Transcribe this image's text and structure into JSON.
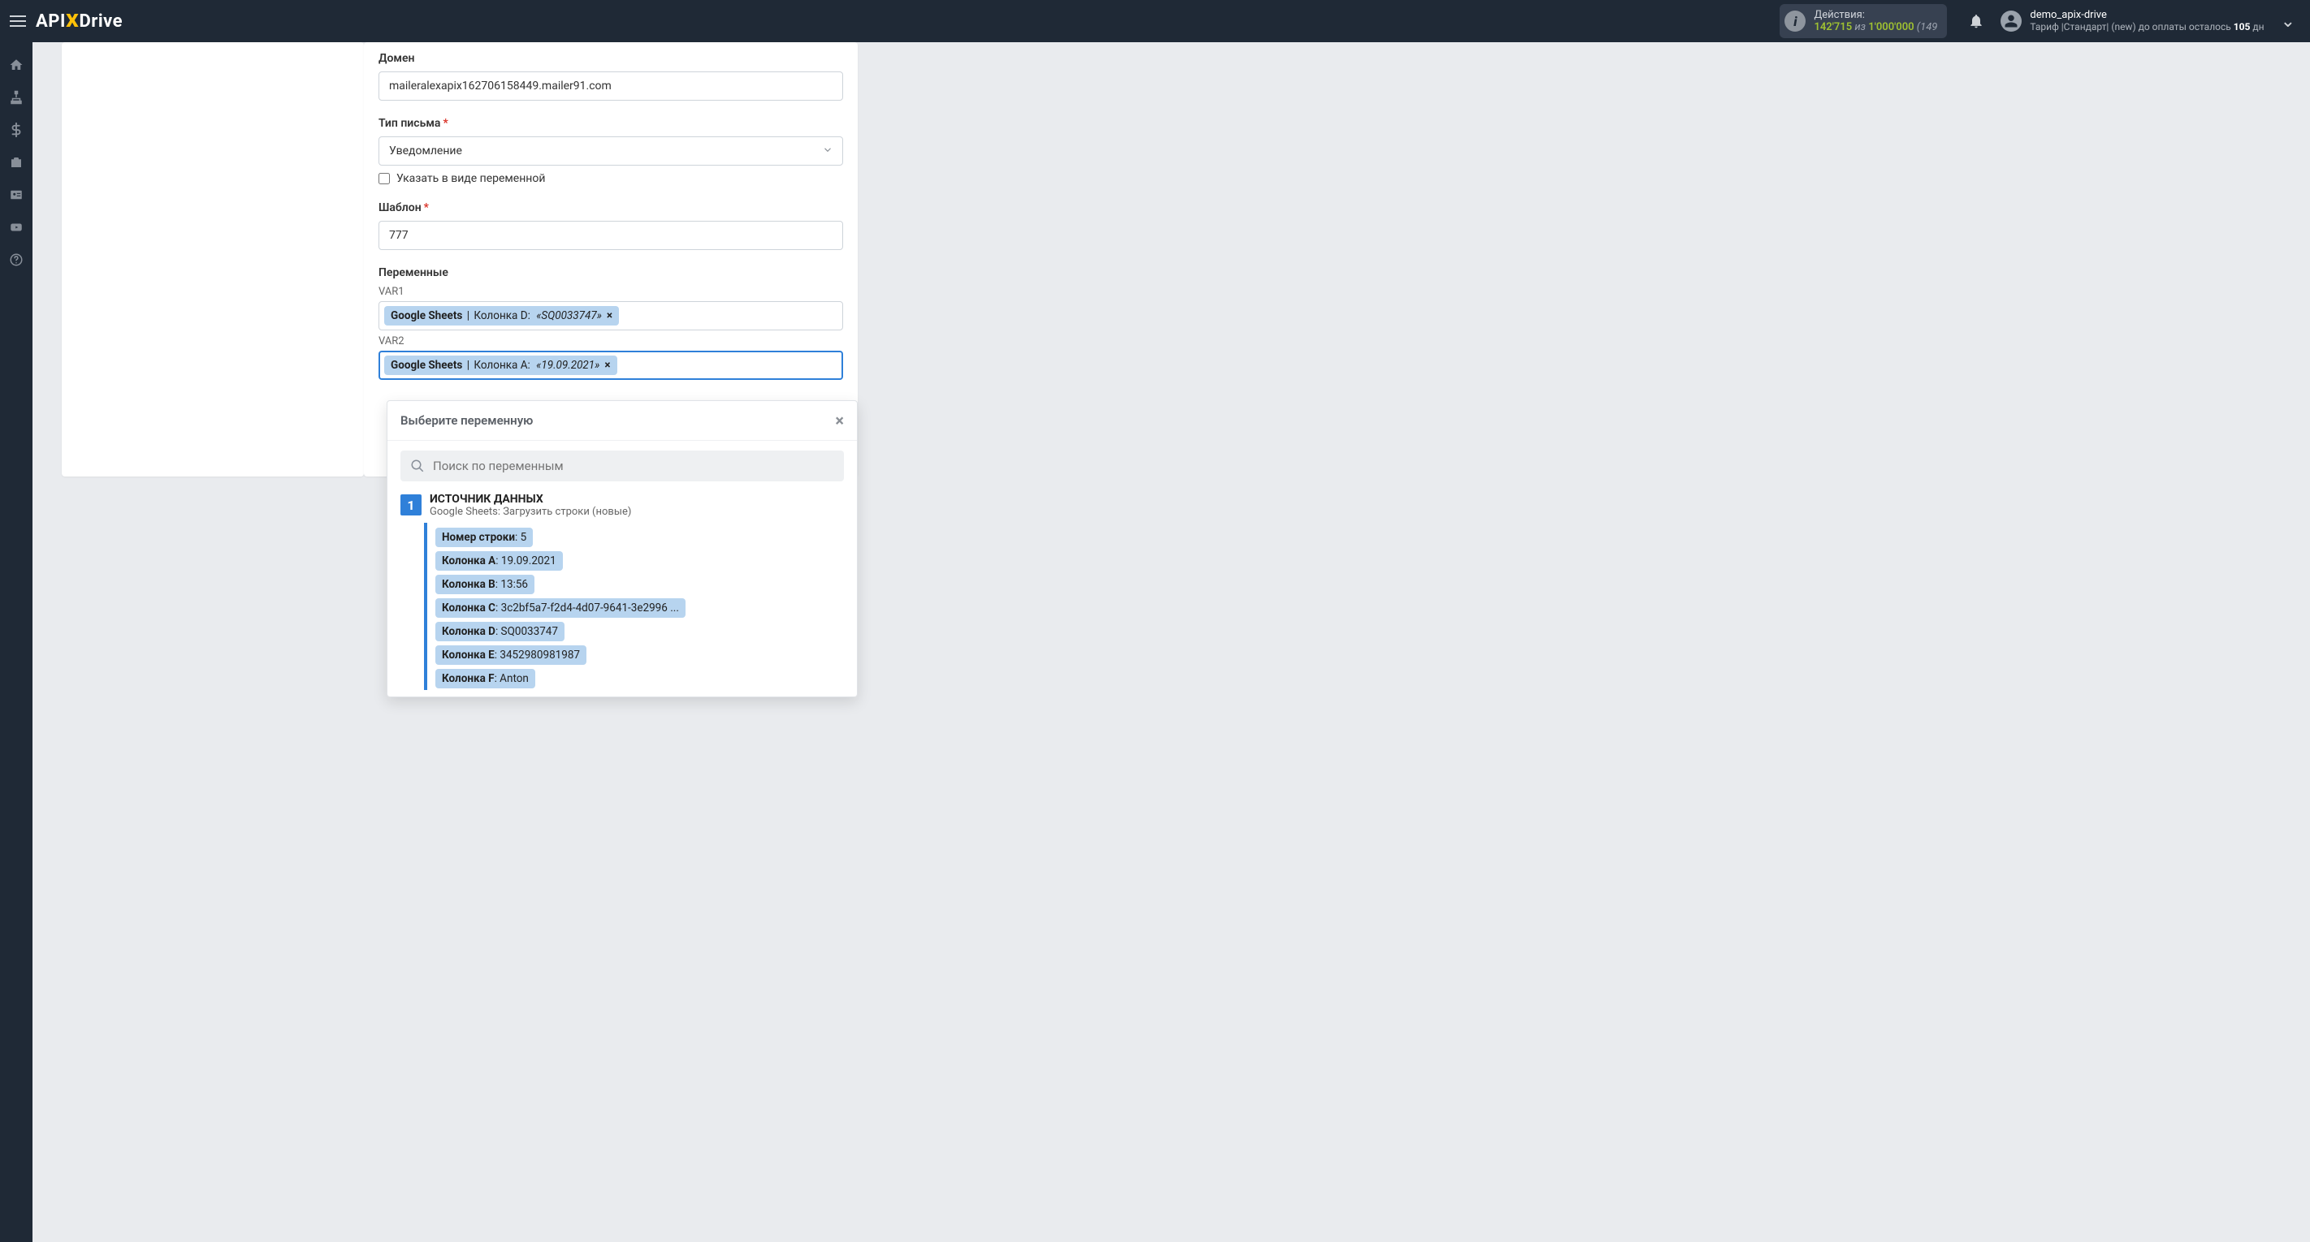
{
  "header": {
    "logo_api": "API",
    "logo_x": "X",
    "logo_drive": "Drive",
    "actions": {
      "label": "Действия:",
      "count": "142'715",
      "of": "из",
      "limit": "1'000'000",
      "extra": "(149"
    },
    "user": {
      "name": "demo_apix-drive",
      "tariff_prefix": "Тариф |Стандарт| (new) до оплаты осталось ",
      "tariff_days": "105",
      "tariff_suffix": " дн"
    }
  },
  "form": {
    "domain_label": "Домен",
    "domain_value": "maileralexapix162706158449.mailer91.com",
    "letter_type_label": "Тип письма",
    "letter_type_value": "Уведомление",
    "letter_type_checkbox": "Указать в виде переменной",
    "template_label": "Шаблон",
    "template_value": "777",
    "vars_label": "Переменные",
    "var1_label": "VAR1",
    "var1_chip": {
      "src": "Google Sheets",
      "col": "Колонка D",
      "val": "«SQ0033747»"
    },
    "var2_label": "VAR2",
    "var2_chip": {
      "src": "Google Sheets",
      "col": "Колонка A",
      "val": "«19.09.2021»"
    }
  },
  "dropdown": {
    "title": "Выберите переменную",
    "search_placeholder": "Поиск по переменным",
    "source": {
      "num": "1",
      "title": "ИСТОЧНИК ДАННЫХ",
      "sub": "Google Sheets: Загрузить строки (новые)"
    },
    "vars": [
      {
        "k": "Номер строки",
        "v": "5"
      },
      {
        "k": "Колонка A",
        "v": "19.09.2021"
      },
      {
        "k": "Колонка B",
        "v": "13:56"
      },
      {
        "k": "Колонка C",
        "v": "3c2bf5a7-f2d4-4d07-9641-3e2996 ..."
      },
      {
        "k": "Колонка D",
        "v": "SQ0033747"
      },
      {
        "k": "Колонка E",
        "v": "3452980981987"
      },
      {
        "k": "Колонка F",
        "v": "Anton"
      }
    ]
  }
}
